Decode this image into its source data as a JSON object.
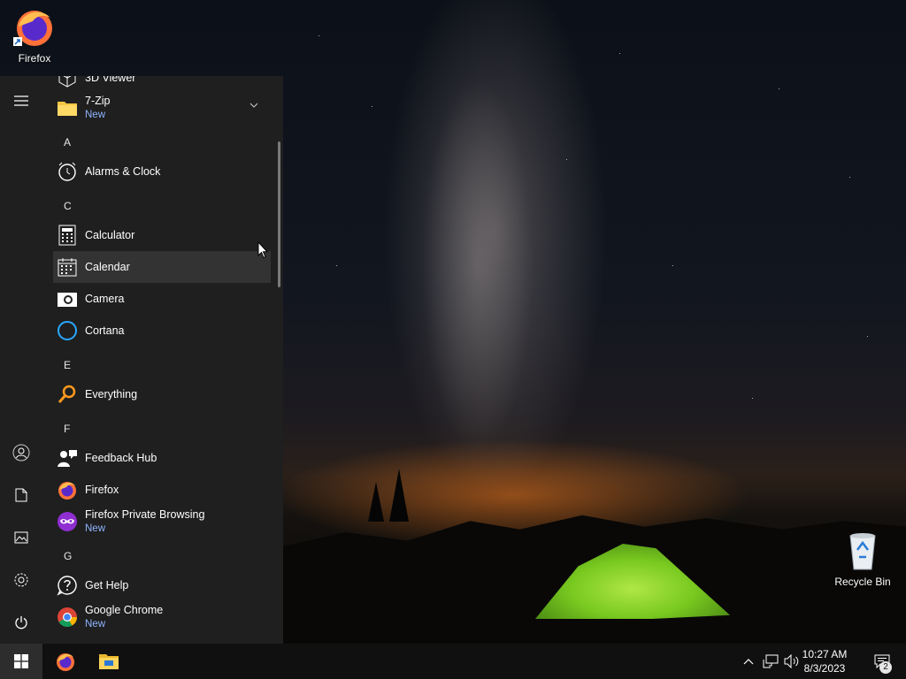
{
  "desktop": {
    "icons": [
      {
        "label": "Firefox"
      },
      {
        "label": "Recycle Bin"
      }
    ]
  },
  "start_menu": {
    "rail": {
      "icons": [
        "hamburger-icon",
        "user-icon",
        "documents-icon",
        "pictures-icon",
        "settings-icon",
        "power-icon"
      ]
    },
    "apps": [
      {
        "label": "3D Viewer"
      },
      {
        "label": "7-Zip",
        "sub": "New"
      },
      {
        "letter": "A"
      },
      {
        "label": "Alarms & Clock"
      },
      {
        "letter": "C"
      },
      {
        "label": "Calculator"
      },
      {
        "label": "Calendar"
      },
      {
        "label": "Camera"
      },
      {
        "label": "Cortana"
      },
      {
        "letter": "E"
      },
      {
        "label": "Everything"
      },
      {
        "letter": "F"
      },
      {
        "label": "Feedback Hub"
      },
      {
        "label": "Firefox"
      },
      {
        "label": "Firefox Private Browsing",
        "sub": "New"
      },
      {
        "letter": "G"
      },
      {
        "label": "Get Help"
      },
      {
        "label": "Google Chrome",
        "sub": "New"
      }
    ]
  },
  "taskbar": {
    "time": "10:27 AM",
    "date": "8/3/2023",
    "notification_count": "2"
  },
  "colors": {
    "menu_bg": "#1f1f1f",
    "hover_bg": "#333333",
    "accent_new": "#8fb4ff",
    "taskbar_bg": "#101010"
  }
}
